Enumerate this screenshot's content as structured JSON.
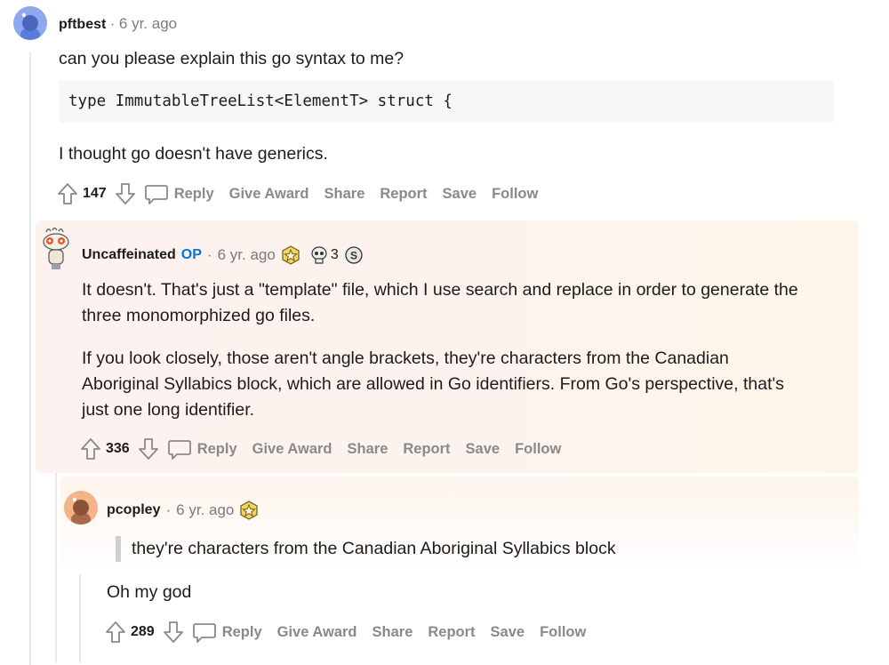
{
  "comments": [
    {
      "username": "pftbest",
      "time": "6 yr. ago",
      "text_before_code": "can you please explain this go syntax to me?",
      "code": "type ImmutableTreeList<ElementT> struct {",
      "text_after_code": "I thought go doesn't have generics.",
      "votes": "147"
    },
    {
      "username": "Uncaffeinated",
      "op_badge": "OP",
      "time": "6 yr. ago",
      "award_count": "3",
      "paragraph1_line1": "It doesn't. That's just a \"template\" file, which I use search and replace in order to generate the",
      "paragraph1_line2": "three monomorphized go files.",
      "paragraph2_line1": "If you look closely, those aren't angle brackets, they're characters from the Canadian",
      "paragraph2_line2": "Aboriginal Syllabics block, which are allowed in Go identifiers. From Go's perspective, that's",
      "paragraph2_line3": "just one long identifier.",
      "votes": "336"
    },
    {
      "username": "pcopley",
      "time": "6 yr. ago",
      "quote": "they're characters from the Canadian Aboriginal Syllabics block",
      "text": "Oh my god",
      "votes": "289"
    }
  ],
  "actions": {
    "reply": "Reply",
    "give_award": "Give Award",
    "share": "Share",
    "report": "Report",
    "save": "Save",
    "follow": "Follow"
  },
  "separator": "·",
  "colors": {
    "accent_op": "#0079d3",
    "action_gray": "#878a8c",
    "highlight_bg": "#fdf2ef",
    "avatar_blue": "#8ea8f0",
    "avatar_orange": "#f3b48a"
  }
}
